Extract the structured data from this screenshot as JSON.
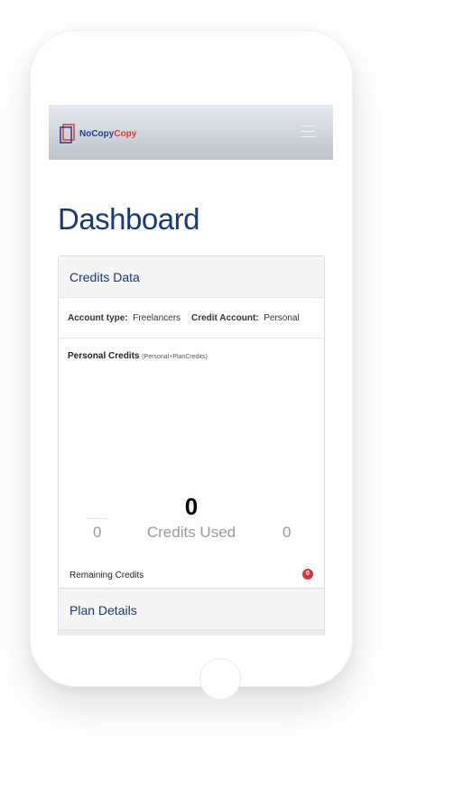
{
  "brand": {
    "name_part1": "NoCopy",
    "name_part2": "Copy"
  },
  "page": {
    "title": "Dashboard"
  },
  "credits_card": {
    "title": "Credits Data",
    "account_type_label": "Account type:",
    "account_type_value": "Freelancers",
    "credit_account_label": "Credit Account:",
    "credit_account_value": "Personal",
    "personal_credits_label": "Personal Credits",
    "personal_credits_sub": "(Personal+PlanCredits)",
    "credits_total": "0",
    "left_value": "0",
    "center_label": "Credits Used",
    "right_value": "0",
    "remaining_label": "Remaining Credits",
    "remaining_badge": "0"
  },
  "plan_card": {
    "title": "Plan Details"
  },
  "colors": {
    "heading": "#16387d",
    "logo_blue": "#1f3f92",
    "logo_red": "#e03a2a",
    "badge": "#d9363e"
  },
  "icons": [
    "logo-icon",
    "hamburger-menu-icon"
  ]
}
